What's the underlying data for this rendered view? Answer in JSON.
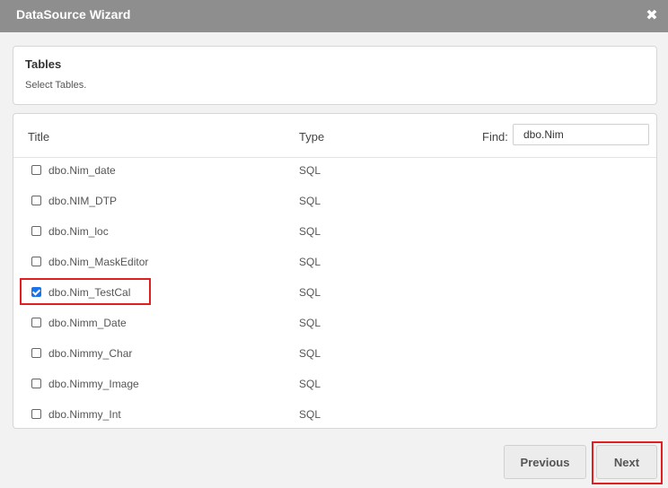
{
  "window": {
    "title": "DataSource Wizard",
    "close_icon": "close-icon"
  },
  "tables_panel": {
    "heading": "Tables",
    "description": "Select Tables."
  },
  "list": {
    "columns": {
      "title": "Title",
      "type": "Type",
      "find_label": "Find:"
    },
    "find_value": "dbo.Nim",
    "rows": [
      {
        "name": "dbo.Nim_date",
        "type": "SQL",
        "checked": false
      },
      {
        "name": "dbo.NIM_DTP",
        "type": "SQL",
        "checked": false
      },
      {
        "name": "dbo.Nim_loc",
        "type": "SQL",
        "checked": false
      },
      {
        "name": "dbo.Nim_MaskEditor",
        "type": "SQL",
        "checked": false
      },
      {
        "name": "dbo.Nim_TestCal",
        "type": "SQL",
        "checked": true
      },
      {
        "name": "dbo.Nimm_Date",
        "type": "SQL",
        "checked": false
      },
      {
        "name": "dbo.Nimmy_Char",
        "type": "SQL",
        "checked": false
      },
      {
        "name": "dbo.Nimmy_Image",
        "type": "SQL",
        "checked": false
      },
      {
        "name": "dbo.Nimmy_Int",
        "type": "SQL",
        "checked": false
      }
    ]
  },
  "buttons": {
    "previous": "Previous",
    "next": "Next"
  },
  "colors": {
    "titlebar": "#8e8e8e",
    "highlight": "#e02020",
    "checkbox_checked": "#1a73e8"
  }
}
